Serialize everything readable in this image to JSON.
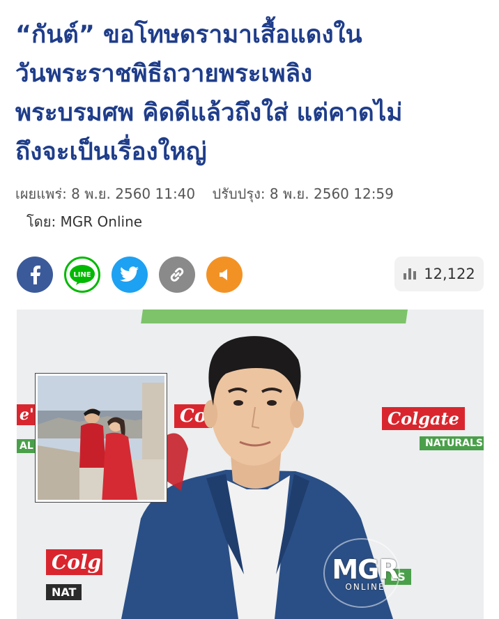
{
  "article": {
    "headline_lines": [
      "“กันต์” ขอโทษดรามาเสื้อแดงใน",
      "วันพระราชพิธีถวายพระเพลิง",
      "พระบรมศพ คิดดีแล้วถึงใส่ แต่คาดไม่",
      "ถึงจะเป็นเรื่องใหญ่"
    ],
    "published": "เผยแพร่: 8 พ.ย. 2560 11:40",
    "updated": "ปรับปรุง: 8 พ.ย. 2560 12:59",
    "byline": "โดย: MGR Online"
  },
  "share": {
    "buttons": [
      {
        "name": "facebook",
        "icon": "facebook-icon",
        "color": "#3b5a9a"
      },
      {
        "name": "line",
        "icon": "line-icon",
        "label": "LINE",
        "color": "#00b900"
      },
      {
        "name": "twitter",
        "icon": "twitter-icon",
        "color": "#1da1f2"
      },
      {
        "name": "copy-link",
        "icon": "link-icon",
        "color": "#8a8a8a"
      },
      {
        "name": "listen",
        "icon": "speaker-icon",
        "color": "#f39224"
      }
    ],
    "views_icon": "bar-chart-icon",
    "views": "12,122"
  },
  "hero": {
    "backdrop_brand": "Colgate",
    "backdrop_sub": "NATURALS",
    "partial_left_brand": "Colg",
    "partial_left_sub": "NAT",
    "partial_mid_brand": "Co",
    "partial_edge": "e'",
    "partial_edge_sub": "AL",
    "partial_ls": "LS",
    "watermark_brand": "MGR",
    "watermark_sub": "ONLINE"
  }
}
